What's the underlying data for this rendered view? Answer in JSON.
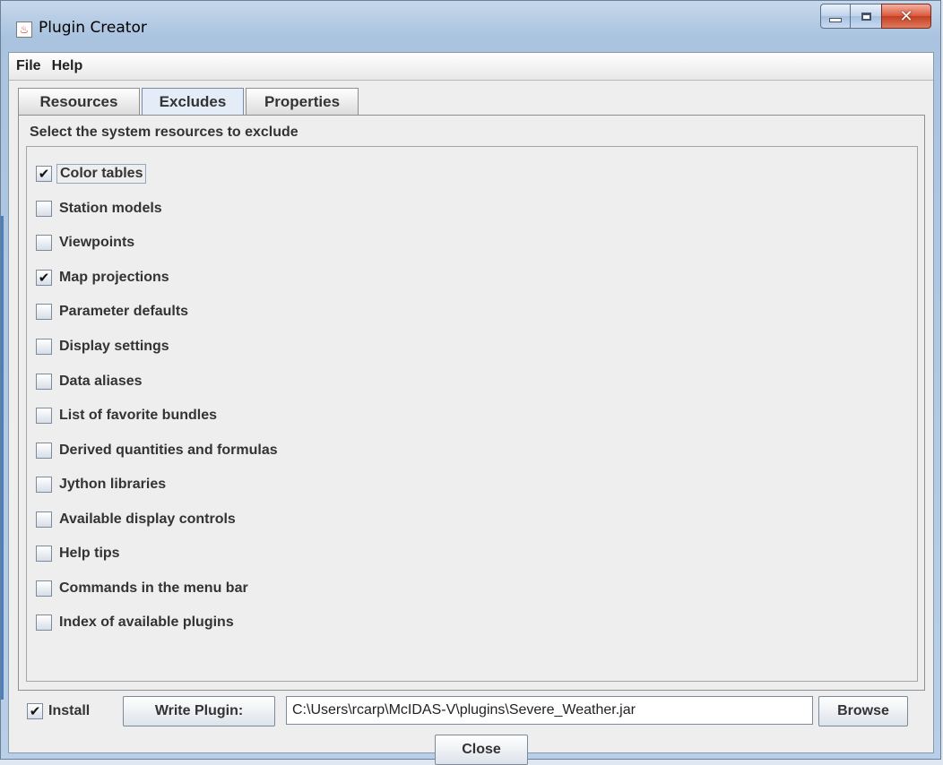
{
  "window": {
    "title": "Plugin Creator"
  },
  "menubar": {
    "items": [
      "File",
      "Help"
    ]
  },
  "tabs": [
    {
      "label": "Resources",
      "active": false
    },
    {
      "label": "Excludes",
      "active": true
    },
    {
      "label": "Properties",
      "active": false
    }
  ],
  "excludes": {
    "heading": "Select the system resources to exclude",
    "items": [
      {
        "label": "Color tables",
        "checked": true
      },
      {
        "label": "Station models",
        "checked": false
      },
      {
        "label": "Viewpoints",
        "checked": false
      },
      {
        "label": "Map projections",
        "checked": true
      },
      {
        "label": "Parameter defaults",
        "checked": false
      },
      {
        "label": "Display settings",
        "checked": false
      },
      {
        "label": "Data aliases",
        "checked": false
      },
      {
        "label": "List of favorite bundles",
        "checked": false
      },
      {
        "label": "Derived quantities and formulas",
        "checked": false
      },
      {
        "label": "Jython libraries",
        "checked": false
      },
      {
        "label": "Available display controls",
        "checked": false
      },
      {
        "label": "Help tips",
        "checked": false
      },
      {
        "label": "Commands in the menu bar",
        "checked": false
      },
      {
        "label": "Index of available plugins",
        "checked": false
      }
    ]
  },
  "footer": {
    "install_label": "Install",
    "install_checked": true,
    "write_plugin_label": "Write Plugin:",
    "plugin_path": "C:\\Users\\rcarp\\McIDAS-V\\plugins\\Severe_Weather.jar",
    "browse_label": "Browse",
    "close_label": "Close"
  }
}
